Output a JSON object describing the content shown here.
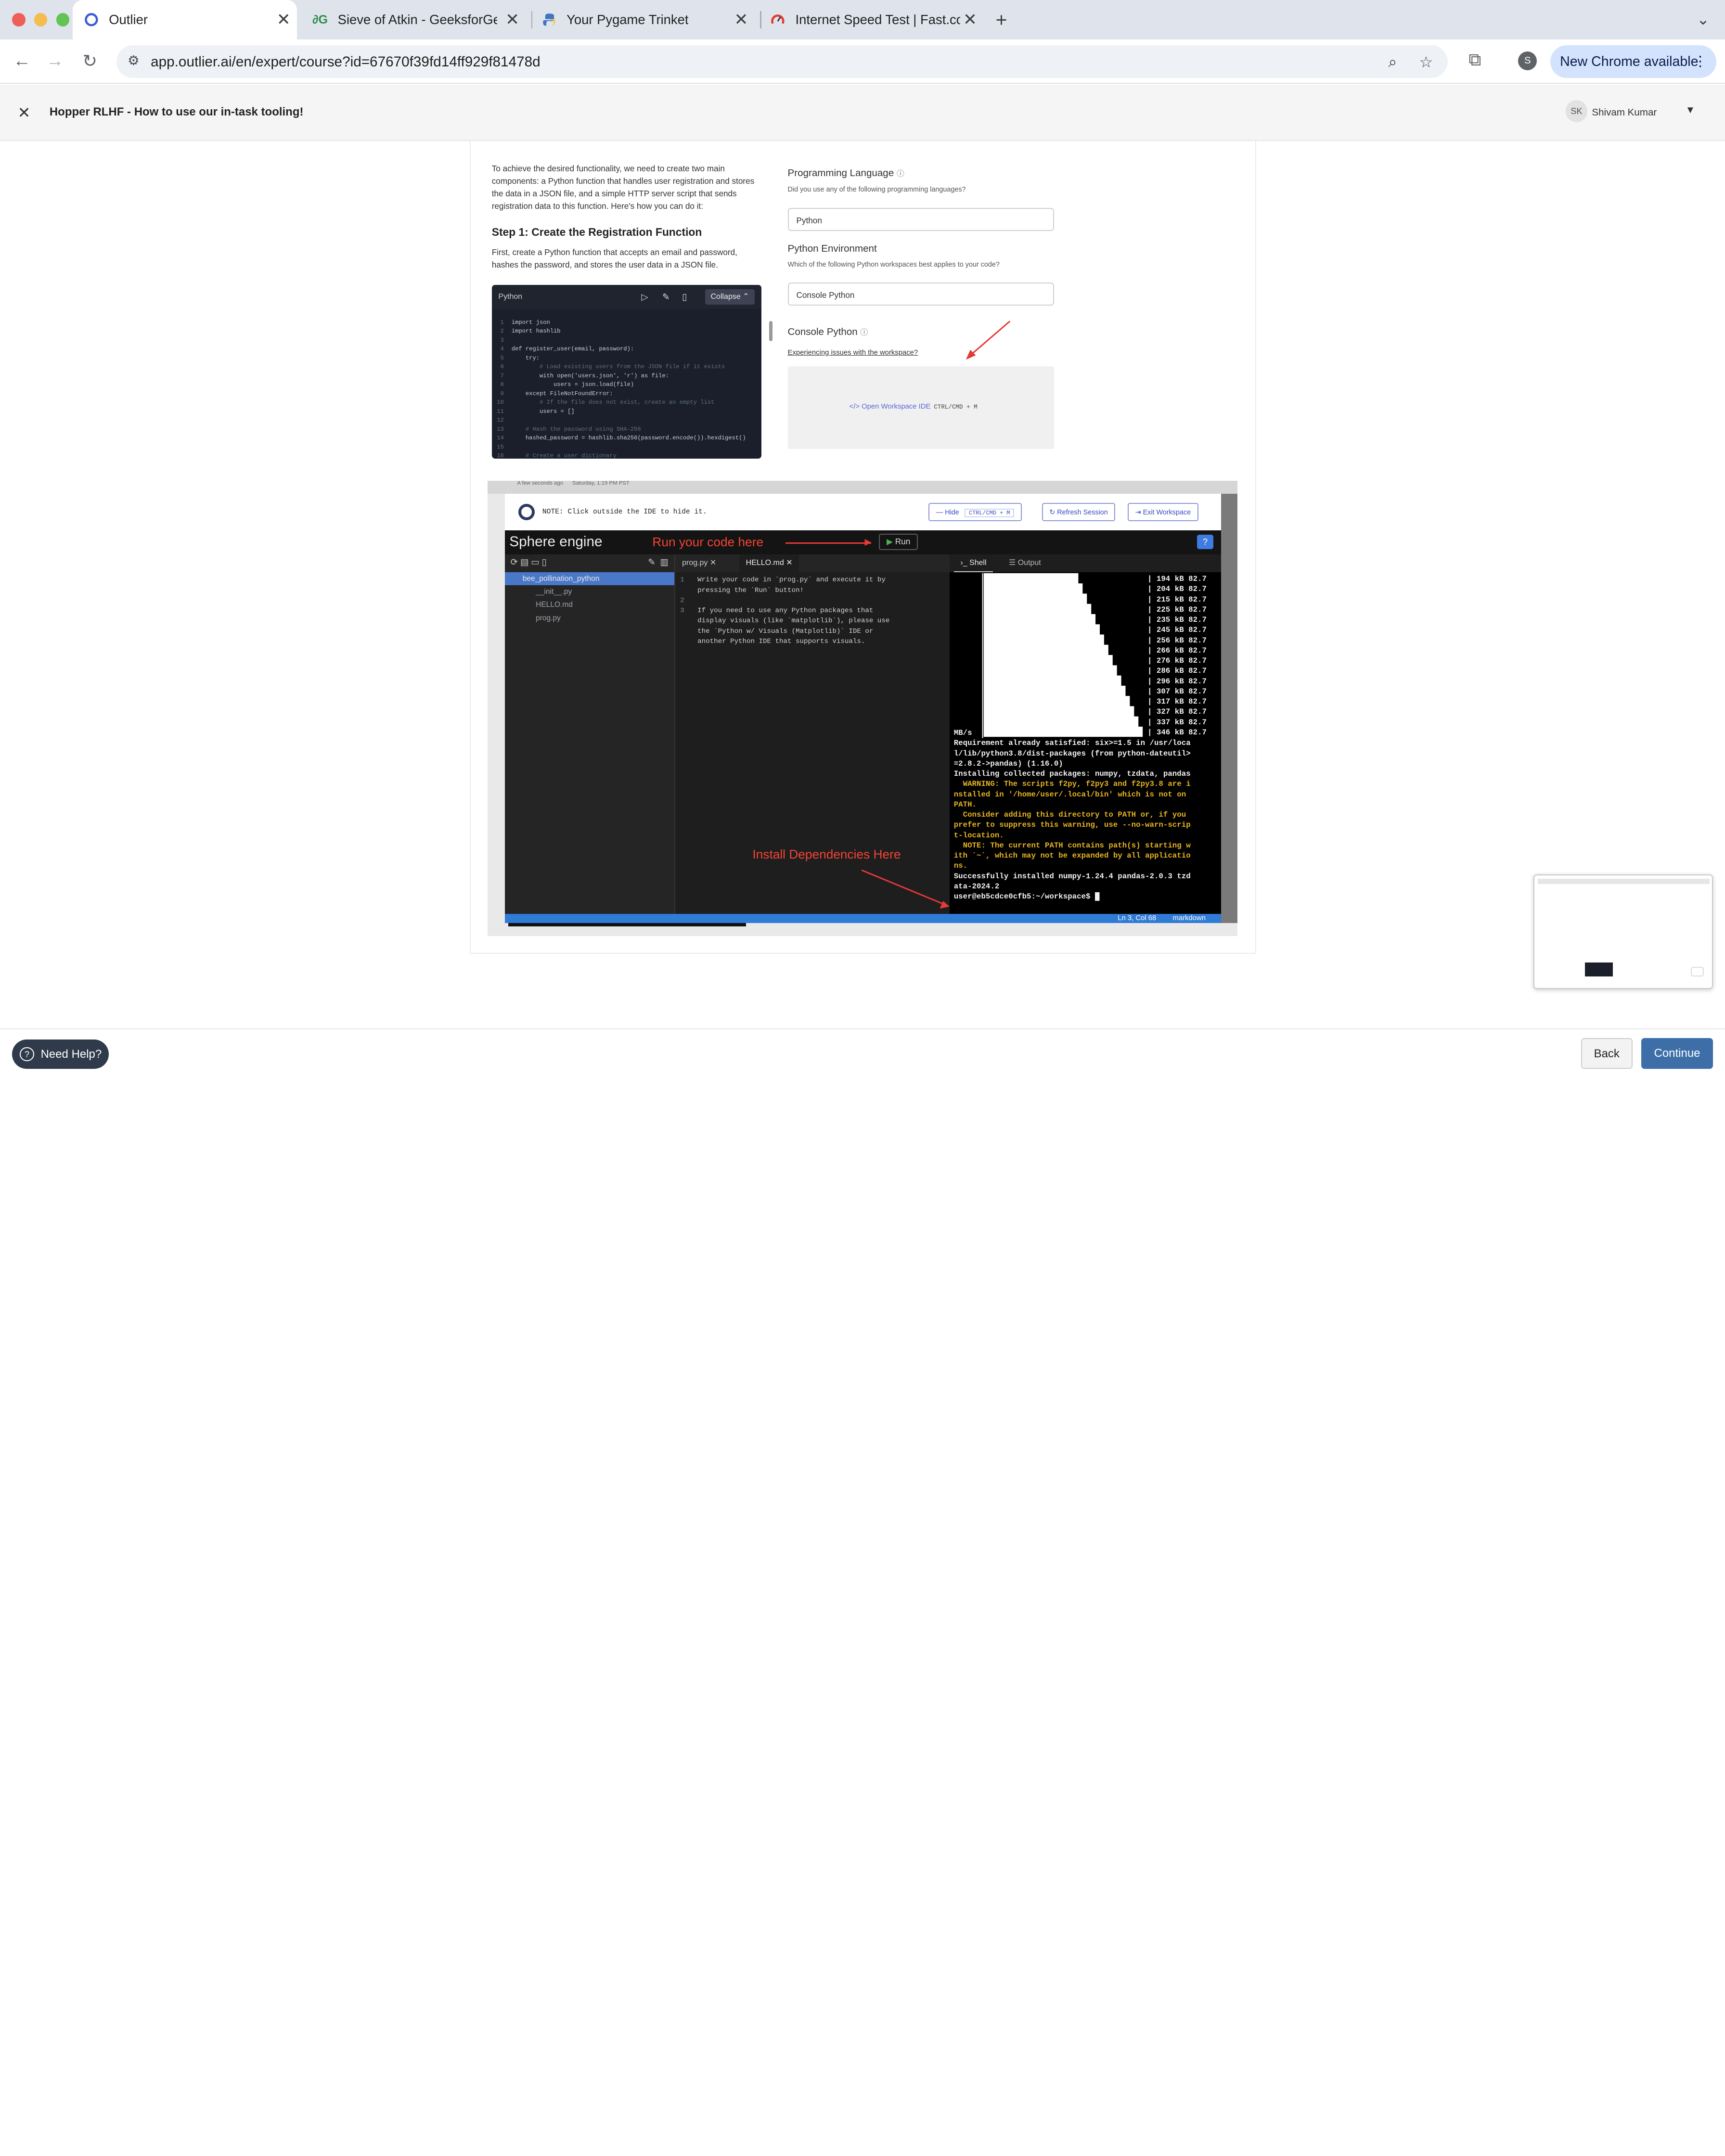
{
  "browser": {
    "tabs": [
      {
        "title": "Outlier",
        "active": true
      },
      {
        "title": "Sieve of Atkin - GeeksforGee"
      },
      {
        "title": "Your Pygame Trinket"
      },
      {
        "title": "Internet Speed Test | Fast.com"
      }
    ],
    "url": "app.outlier.ai/en/expert/course?id=67670f39fd14ff929f81478d",
    "profile_initial": "S",
    "update_label": "New Chrome available"
  },
  "header": {
    "title": "Hopper RLHF - How to use our in-task tooling!",
    "user_initials": "SK",
    "user_name": "Shivam Kumar"
  },
  "left": {
    "intro": "To achieve the desired functionality, we need to create two main components: a Python function that handles user registration and stores the data in a JSON file, and a simple HTTP server script that sends registration data to this function. Here's how you can do it:",
    "step_title": "Step 1: Create the Registration Function",
    "step_text": "First, create a Python function that accepts an email and password, hashes the password, and stores the user data in a JSON file.",
    "code_lang": "Python",
    "collapse_label": "Collapse",
    "code_lines": [
      "import json",
      "import hashlib",
      "",
      "def register_user(email, password):",
      "    try:",
      "        # Load existing users from the JSON file if it exists",
      "        with open('users.json', 'r') as file:",
      "            users = json.load(file)",
      "    except FileNotFoundError:",
      "        # If the file does not exist, create an empty list",
      "        users = []",
      "",
      "    # Hash the password using SHA-256",
      "    hashed_password = hashlib.sha256(password.encode()).hexdigest()",
      "",
      "    # Create a user dictionary"
    ]
  },
  "right": {
    "lang_label": "Programming Language",
    "lang_question": "Did you use any of the following programming languages?",
    "lang_value": "Python",
    "env_label": "Python Environment",
    "env_question": "Which of the following Python workspaces best applies to your code?",
    "env_value": "Console Python",
    "console_label": "Console Python",
    "issues_link": "Experiencing issues with the workspace?",
    "open_ide": "Open Workspace IDE",
    "open_ide_kbd": "CTRL/CMD + M"
  },
  "ide": {
    "strip_left": "A few seconds ago",
    "strip_right": "Saturday, 1:19 PM PST",
    "note": "NOTE: Click outside the IDE to hide it.",
    "hide": "Hide",
    "hide_kbd": "CTRL/CMD + M",
    "refresh": "Refresh Session",
    "exit": "Exit Workspace",
    "brand": "Sphere engine",
    "run_annotation": "Run your code here",
    "run_button": "Run",
    "help": "?",
    "tree": [
      "bee_pollination_python",
      "__init__.py",
      "HELLO.md",
      "prog.py"
    ],
    "editor_tabs": [
      "prog.py",
      "HELLO.md"
    ],
    "editor_lines": [
      "Write your code in `prog.py` and execute it by",
      "pressing the `Run` button!",
      "",
      "If you need to use any Python packages that",
      "display visuals (like `matplotlib`), please use",
      "the `Python w/ Visuals (Matplotlib)` IDE or",
      "another Python IDE that supports visuals."
    ],
    "editor_line_numbers": [
      "1",
      "",
      "2",
      "3",
      "",
      "",
      ""
    ],
    "term_tabs": [
      "Shell",
      "Output"
    ],
    "progress_values": [
      "194 kB 82.7",
      "204 kB 82.7",
      "215 kB 82.7",
      "225 kB 82.7",
      "235 kB 82.7",
      "245 kB 82.7",
      "256 kB 82.7",
      "266 kB 82.7",
      "276 kB 82.7",
      "286 kB 82.7",
      "296 kB 82.7",
      "307 kB 82.7",
      "317 kB 82.7",
      "327 kB 82.7",
      "337 kB 82.7",
      "346 kB 82.7"
    ],
    "term_lines": [
      "MB/s",
      "Requirement already satisfied: six>=1.5 in /usr/loca",
      "l/lib/python3.8/dist-packages (from python-dateutil>",
      "=2.8.2->pandas) (1.16.0)",
      "Installing collected packages: numpy, tzdata, pandas",
      "  WARNING: The scripts f2py, f2py3 and f2py3.8 are i",
      "nstalled in '/home/user/.local/bin' which is not on",
      "PATH.",
      "  Consider adding this directory to PATH or, if you",
      "prefer to suppress this warning, use --no-warn-scrip",
      "t-location.",
      "  NOTE: The current PATH contains path(s) starting w",
      "ith `~`, which may not be expanded by all applicatio",
      "ns.",
      "Successfully installed numpy-1.24.4 pandas-2.0.3 tzd",
      "ata-2024.2",
      "user@eb5cdce0cfb5:~/workspace$ "
    ],
    "install_annotation": "Install Dependencies Here",
    "status_pos": "Ln 3, Col 68",
    "status_lang": "markdown"
  },
  "footer": {
    "help": "Need Help?",
    "back": "Back",
    "continue": "Continue"
  }
}
